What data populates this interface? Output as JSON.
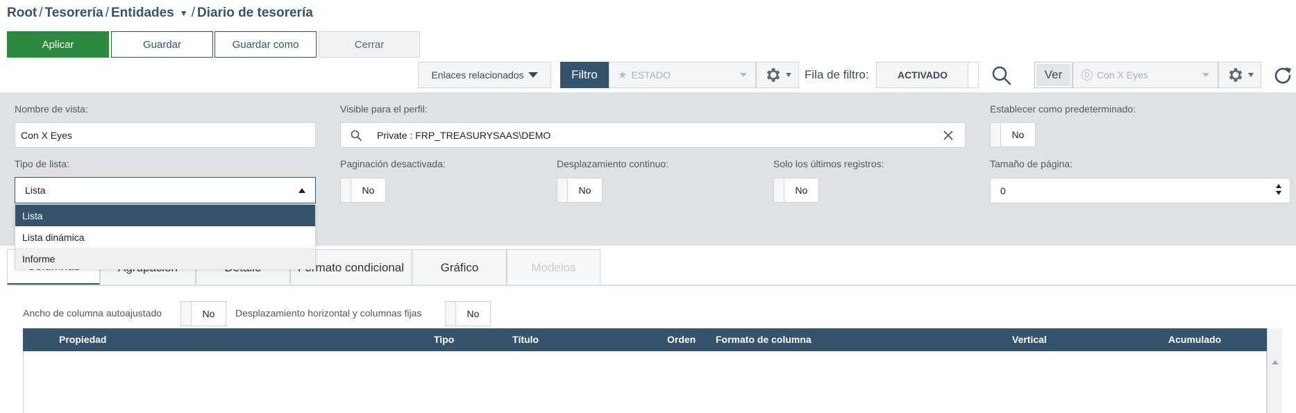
{
  "breadcrumb": {
    "root": "Root",
    "tesoreria": "Tesorería",
    "entidades": "Entidades",
    "current": "Diario de tesorería",
    "sep": "/"
  },
  "actions": {
    "aplicar": "Aplicar",
    "guardar": "Guardar",
    "guardar_como": "Guardar como",
    "cerrar": "Cerrar"
  },
  "toolbar": {
    "enlaces": "Enlaces relacionados",
    "filtro": "Filtro",
    "estado_placeholder": "ESTADO",
    "fila_de_filtro_label": "Fila de filtro:",
    "fila_de_filtro_value": "ACTIVADO",
    "ver": "Ver",
    "view_selected": "Con X Eyes",
    "view_badge": "D"
  },
  "panel": {
    "nombre_label": "Nombre de vista:",
    "nombre_value": "Con X Eyes",
    "visible_label": "Visible para el perfil:",
    "visible_value": "Private : FRP_TREASURYSAAS\\DEMO",
    "predeterminado_label": "Establecer como predeterminado:",
    "predeterminado_value": "No",
    "tipo_label": "Tipo de lista:",
    "tipo_value": "Lista",
    "tipo_options": [
      "Lista",
      "Lista dinámica",
      "Informe"
    ],
    "paginacion_label": "Paginación desactivada:",
    "paginacion_value": "No",
    "desplazamiento_label": "Desplazamiento continuo:",
    "desplazamiento_value": "No",
    "ultimos_label": "Solo los últimos registros:",
    "ultimos_value": "No",
    "tamano_label": "Tamaño de página:",
    "tamano_value": "0"
  },
  "tabs": {
    "columnas": "Columnas",
    "agrupacion": "Agrupación",
    "detalle": "Detalle",
    "formato": "Formato condicional",
    "grafico": "Gráfico",
    "modelos": "Modelos"
  },
  "column_options": {
    "ancho_label": "Ancho de columna autoajustado",
    "ancho_value": "No",
    "horizontal_label": "Desplazamiento horizontal y columnas fijas",
    "horizontal_value": "No"
  },
  "table": {
    "headers": {
      "propiedad": "Propiedad",
      "tipo": "Tipo",
      "titulo": "Título",
      "orden": "Orden",
      "formato": "Formato de columna",
      "vertical": "Vertical",
      "acumulado": "Acumulado"
    }
  },
  "colors": {
    "primary": "#34546e",
    "success": "#2b8a3e",
    "panel_bg": "#dfe2e5"
  }
}
